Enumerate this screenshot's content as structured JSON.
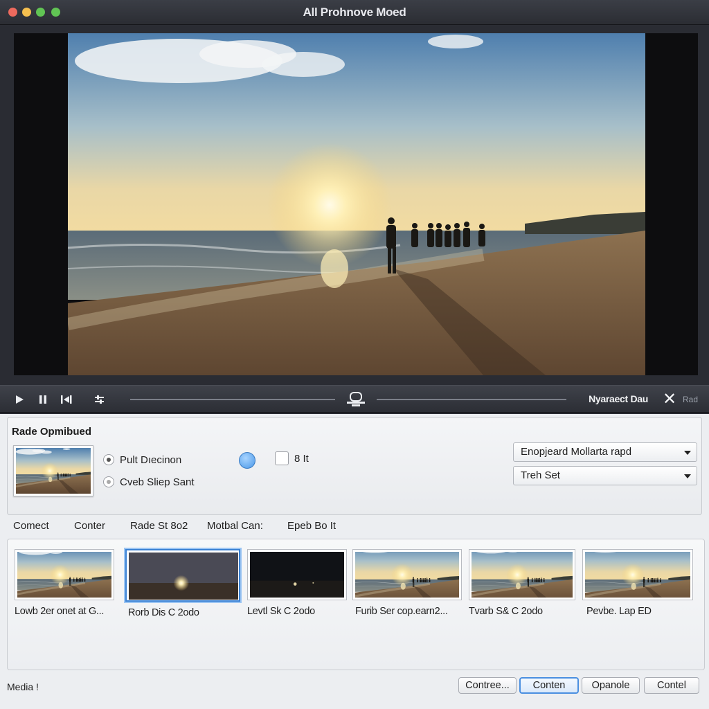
{
  "window": {
    "title": "All Prohnove Moed"
  },
  "transport": {
    "label": "Nyaraect Dau",
    "close_label": "Rad"
  },
  "options": {
    "title": "Rade Opmibued",
    "radios": [
      {
        "label": "Pult Dıecinon",
        "selected": true
      },
      {
        "label": "Cveb Sliep Sant",
        "selected": false
      }
    ],
    "checkbox_label": "8 It",
    "selects": [
      {
        "value": "Enopjeard Mollarta rapd"
      },
      {
        "value": "Treh Set"
      }
    ]
  },
  "tabs": [
    "Comect",
    "Conter",
    "Rade St 8o2",
    "Motbal Can:",
    "Epeb Bo It"
  ],
  "gallery": {
    "items": [
      {
        "label": "Lowb 2er onet at G...",
        "selected": false
      },
      {
        "label": "Rorb Dis C 2odo",
        "selected": true
      },
      {
        "label": "Levtl Sk C 2odo",
        "selected": false
      },
      {
        "label": "Furib Ser cop.earn2...",
        "selected": false
      },
      {
        "label": "Tvarb S& C 2odo",
        "selected": false
      },
      {
        "label": "Pevbe. Lap ED",
        "selected": false
      }
    ]
  },
  "footer": {
    "status": "Media !",
    "buttons": [
      "Contree...",
      "Conten",
      "Opanole",
      "Contel"
    ]
  },
  "colors": {
    "accent": "#3b82d4",
    "titlebar": "#2b2d33",
    "panel": "#eceef1"
  }
}
